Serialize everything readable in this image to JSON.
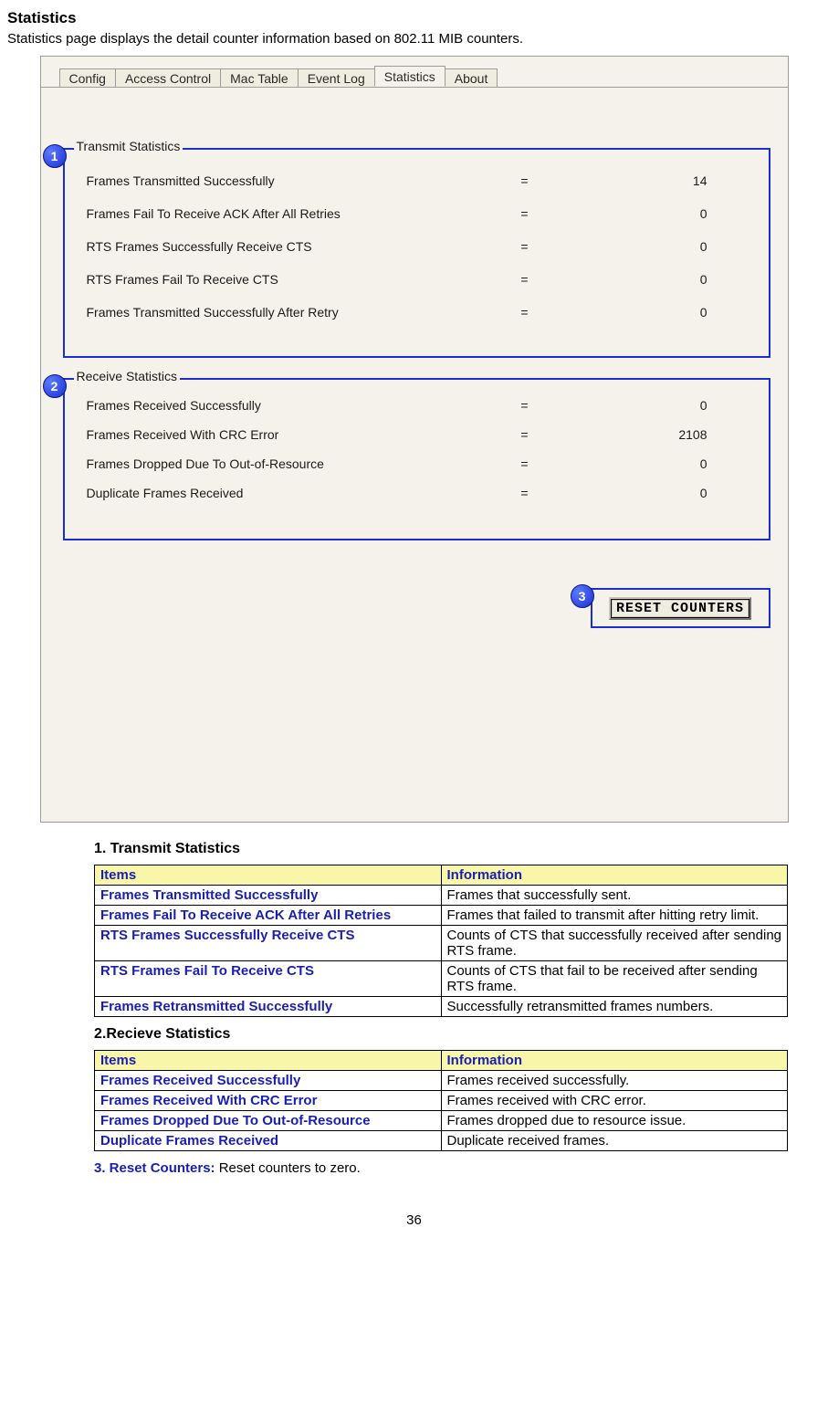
{
  "page": {
    "title": "Statistics",
    "intro": "Statistics page displays the detail counter information based on 802.11 MIB counters.",
    "number": "36"
  },
  "dialog": {
    "tabs": {
      "config": "Config",
      "access_control": "Access Control",
      "mac_table": "Mac Table",
      "event_log": "Event Log",
      "statistics": "Statistics",
      "about": "About"
    },
    "callouts": {
      "c1": "1",
      "c2": "2",
      "c3": "3"
    },
    "transmit": {
      "legend": "Transmit Statistics",
      "rows": [
        {
          "label": "Frames Transmitted Successfully",
          "eq": "=",
          "val": "14"
        },
        {
          "label": "Frames Fail To Receive ACK After All Retries",
          "eq": "=",
          "val": "0"
        },
        {
          "label": "RTS Frames Successfully Receive CTS",
          "eq": "=",
          "val": "0"
        },
        {
          "label": "RTS Frames Fail To Receive CTS",
          "eq": "=",
          "val": "0"
        },
        {
          "label": "Frames Transmitted Successfully After Retry",
          "eq": "=",
          "val": "0"
        }
      ]
    },
    "receive": {
      "legend": "Receive Statistics",
      "rows": [
        {
          "label": "Frames Received Successfully",
          "eq": "=",
          "val": "0"
        },
        {
          "label": "Frames Received With CRC Error",
          "eq": "=",
          "val": "2108"
        },
        {
          "label": "Frames Dropped Due To Out-of-Resource",
          "eq": "=",
          "val": "0"
        },
        {
          "label": "Duplicate Frames Received",
          "eq": "=",
          "val": "0"
        }
      ]
    },
    "reset_label": "RESET COUNTERS"
  },
  "sections": {
    "s1_title": "1. Transmit Statistics",
    "s2_title": "2.Recieve Statistics",
    "s3_bold": "3. Reset Counters:",
    "s3_rest": " Reset counters to zero.",
    "headers": {
      "items": "Items",
      "info": "Information"
    },
    "table1": [
      {
        "item": "Frames Transmitted Successfully",
        "info": "Frames that successfully sent."
      },
      {
        "item": "Frames Fail To Receive ACK After All Retries",
        "info": "Frames that failed to transmit after hitting retry limit."
      },
      {
        "item": "RTS Frames Successfully Receive CTS",
        "info": "Counts of CTS that successfully received after sending RTS frame."
      },
      {
        "item": "RTS Frames Fail To Receive CTS",
        "info": "Counts of CTS that fail to be received after sending RTS frame."
      },
      {
        "item": "Frames Retransmitted Successfully",
        "info": "Successfully retransmitted frames numbers."
      }
    ],
    "table2": [
      {
        "item": "Frames Received Successfully",
        "info": "Frames received successfully."
      },
      {
        "item": "Frames Received With CRC Error",
        "info": "Frames received with CRC error."
      },
      {
        "item": "Frames Dropped Due To Out-of-Resource",
        "info": "Frames dropped due to resource issue."
      },
      {
        "item": "Duplicate Frames Received",
        "info": "Duplicate received frames."
      }
    ]
  }
}
